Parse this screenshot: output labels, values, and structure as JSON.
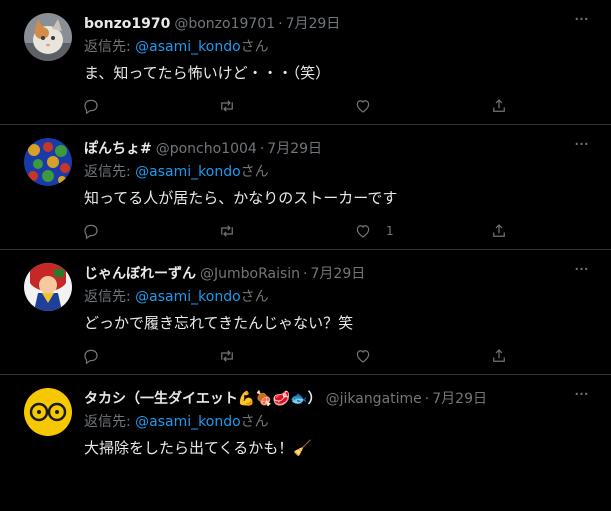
{
  "replies": [
    {
      "name": "bonzo1970",
      "handle": "@bonzo19701",
      "date": "7月29日",
      "reply_prefix": "返信先: ",
      "mention": "@asami_kondo",
      "reply_suffix": "さん",
      "text": "ま、知ってたら怖いけど・・・（笑）",
      "like_count": ""
    },
    {
      "name": "ぽんちょ#",
      "handle": "@poncho1004",
      "date": "7月29日",
      "reply_prefix": "返信先: ",
      "mention": "@asami_kondo",
      "reply_suffix": "さん",
      "text": "知ってる人が居たら、かなりのストーカーです",
      "like_count": "1"
    },
    {
      "name": "じゃんぼれーずん",
      "handle": "@JumboRaisin",
      "date": "7月29日",
      "reply_prefix": "返信先: ",
      "mention": "@asami_kondo",
      "reply_suffix": "さん",
      "text": "どっかで履き忘れてきたんじゃない？笑",
      "like_count": ""
    },
    {
      "name": "タカシ（一生ダイエット💪🍖🥩🐟）",
      "handle": "@jikangatime",
      "date": "7月29日",
      "reply_prefix": "返信先: ",
      "mention": "@asami_kondo",
      "reply_suffix": "さん",
      "text": "大掃除をしたら出てくるかも！🧹",
      "like_count": ""
    }
  ],
  "icons": {
    "more": "more-dots-icon",
    "reply": "reply-bubble-icon",
    "retweet": "retweet-icon",
    "like": "heart-icon",
    "share": "share-icon"
  },
  "colors": {
    "background": "#000000",
    "text": "#e7e9ea",
    "muted": "#71767b",
    "link": "#1d9bf0",
    "divider": "#2f3336"
  }
}
